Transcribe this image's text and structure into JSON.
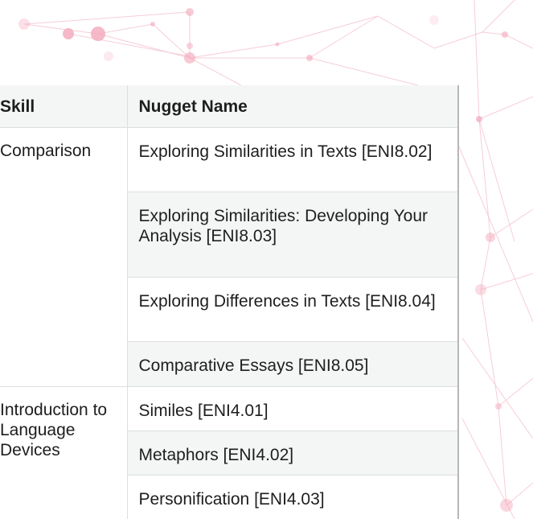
{
  "table": {
    "headers": {
      "skill": "Skill",
      "nugget": "Nugget Name"
    },
    "groups": [
      {
        "skill": "Comparison",
        "nuggets": [
          "Exploring Similarities in Texts [ENI8.02]",
          "Exploring Similarities: Developing Your Analysis [ENI8.03]",
          "Exploring Differences in Texts [ENI8.04]",
          "Comparative Essays [ENI8.05]"
        ]
      },
      {
        "skill": "Introduction to Language Devices",
        "nuggets": [
          "Similes [ENI4.01]",
          "Metaphors [ENI4.02]",
          "Personification [ENI4.03]"
        ]
      }
    ]
  },
  "decor": {
    "line_color": "#f6c2d0",
    "dot_color": "#f4a3b8"
  }
}
